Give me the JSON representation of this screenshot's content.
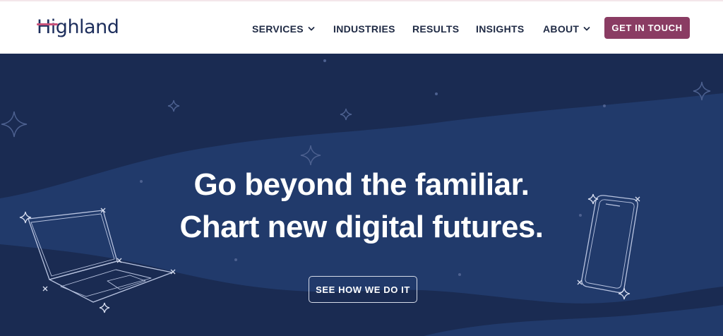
{
  "brand": {
    "logo_text": "Highland"
  },
  "nav": {
    "items": [
      {
        "label": "SERVICES",
        "has_dropdown": true
      },
      {
        "label": "INDUSTRIES",
        "has_dropdown": false
      },
      {
        "label": "RESULTS",
        "has_dropdown": false
      },
      {
        "label": "INSIGHTS",
        "has_dropdown": false
      },
      {
        "label": "ABOUT",
        "has_dropdown": true
      }
    ],
    "cta_label": "GET IN TOUCH"
  },
  "hero": {
    "headline_line1": "Go beyond the familiar.",
    "headline_line2": "Chart new digital futures.",
    "button_label": "SEE HOW WE DO IT"
  },
  "colors": {
    "header_bg": "#ffffff",
    "hero_bg": "#1a2b52",
    "hero_wave": "#213a6b",
    "cta_bg": "#8a3c63",
    "logo_accent": "#c8527a",
    "text_dark": "#1f2a44"
  },
  "icons": [
    "chevron-down-icon",
    "sparkle-icon",
    "laptop-illustration",
    "phone-illustration"
  ]
}
